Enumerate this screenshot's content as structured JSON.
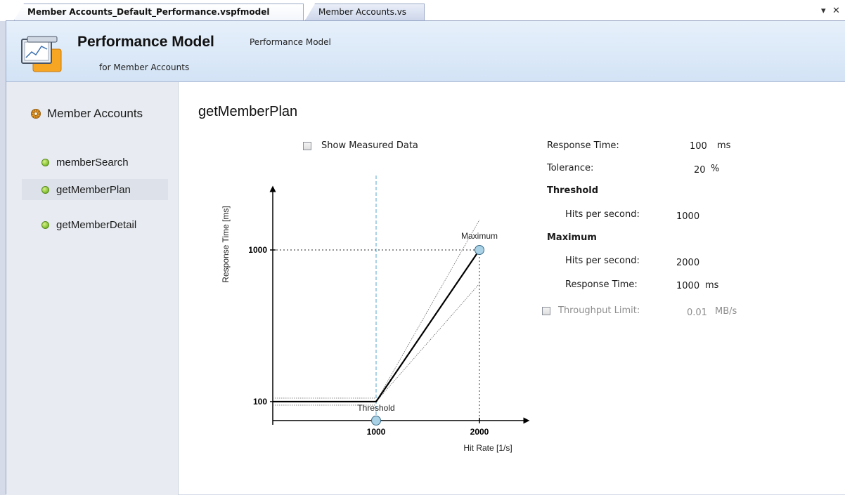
{
  "tabs": [
    {
      "label": "Member Accounts_Default_Performance.vspfmodel",
      "active": true
    },
    {
      "label": "Member Accounts.vs",
      "active": false
    }
  ],
  "tab_controls": {
    "dropdown": "▾",
    "close": "✕"
  },
  "header": {
    "title": "Performance Model",
    "subtitle": "Performance Model",
    "for_text": "for Member Accounts",
    "icon": "performance-model-icon"
  },
  "sidebar": {
    "root": {
      "label": "Member Accounts",
      "icon": "gear-icon"
    },
    "items": [
      {
        "label": "memberSearch",
        "selected": false
      },
      {
        "label": "getMemberPlan",
        "selected": true
      },
      {
        "label": "getMemberDetail",
        "selected": false
      }
    ]
  },
  "operation": {
    "title": "getMemberPlan",
    "show_measured_label": "Show Measured Data",
    "show_measured_checked": false
  },
  "chart_data": {
    "type": "line",
    "xlabel": "Hit Rate [1/s]",
    "ylabel": "Response Time [ms]",
    "x_ticks": [
      1000,
      2000
    ],
    "y_ticks": [
      100,
      1000
    ],
    "series": [
      {
        "x": [
          0,
          1000,
          2000
        ],
        "y": [
          100,
          100,
          1000
        ]
      }
    ],
    "tolerance_percent": 20,
    "annotations": [
      {
        "label": "Threshold",
        "x": 1000,
        "y": 100
      },
      {
        "label": "Maximum",
        "x": 2000,
        "y": 1000
      }
    ],
    "colors": {
      "threshold_line": "#8ec3de",
      "marker_fill": "#a9d2e6",
      "marker_stroke": "#3b6a85"
    }
  },
  "properties": {
    "response_time": {
      "label": "Response Time:",
      "value": "100",
      "unit": "ms"
    },
    "tolerance": {
      "label": "Tolerance:",
      "value": "20",
      "unit": "%"
    },
    "threshold_heading": "Threshold",
    "threshold_hits": {
      "label": "Hits per second:",
      "value": "1000"
    },
    "maximum_heading": "Maximum",
    "maximum_hits": {
      "label": "Hits per second:",
      "value": "2000"
    },
    "maximum_response": {
      "label": "Response Time:",
      "value": "1000",
      "unit": "ms"
    },
    "throughput": {
      "label": "Throughput Limit:",
      "value": "0.01",
      "unit": "MB/s",
      "checked": false
    }
  }
}
